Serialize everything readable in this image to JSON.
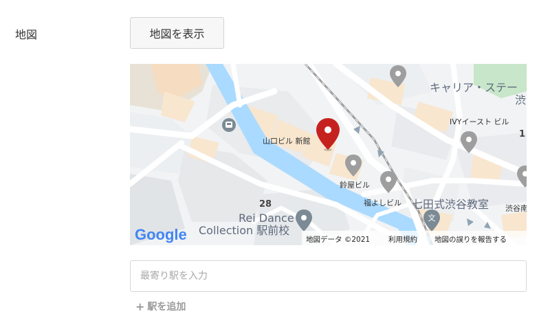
{
  "section": {
    "label": "地図",
    "show_map_button": "地図を表示"
  },
  "map": {
    "google_logo": "Google",
    "building_labels": {
      "main": "山口ビル 新館",
      "suzuya": "鈴屋ビル",
      "fukuyoshi": "福よしビル",
      "ivy": "IVYイースト ビル",
      "career": "キャリア・ステー",
      "career_2": "渋",
      "number_28": "28",
      "rei_dance_1": "Rei Dance",
      "rei_dance_2": "Collection 駅前校",
      "nanada": "七田式渋谷教室",
      "shibuya_cut": "渋谷南",
      "number_1": "1"
    },
    "footer": {
      "map_data": "地図データ ©2021",
      "terms": "利用規約",
      "report": "地図の誤りを報告する"
    },
    "colors": {
      "pin_red": "#c5221f",
      "road": "#ffffff",
      "water": "#aadaff",
      "building": "#f8e6cf",
      "park": "#c8e6c9"
    }
  },
  "station": {
    "placeholder": "最寄り駅を入力",
    "value": "",
    "add_label": "駅を追加",
    "add_icon": "plus-icon"
  }
}
